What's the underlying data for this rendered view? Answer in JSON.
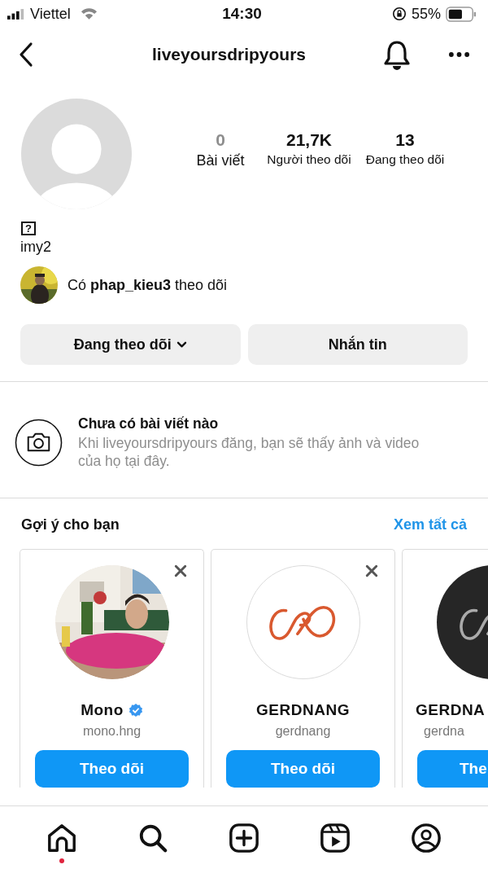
{
  "status_bar": {
    "carrier": "Viettel",
    "time": "14:30",
    "battery": "55%"
  },
  "nav": {
    "title": "liveyoursdripyours"
  },
  "profile": {
    "stats": [
      {
        "value": "0",
        "label": "Bài viết",
        "muted": true
      },
      {
        "value": "21,7K",
        "label": "Người theo dõi",
        "muted": false
      },
      {
        "value": "13",
        "label": "Đang theo dõi",
        "muted": false
      }
    ],
    "bio_symbol": "?",
    "name": "imy2",
    "followed_by": "Có **phap_kieu3** theo dõi"
  },
  "actions": [
    {
      "label": "Đang theo dõi",
      "dropdown": true
    },
    {
      "label": "Nhắn tin",
      "dropdown": false
    }
  ],
  "empty_state": {
    "title": "Chưa có bài viết nào",
    "text": "Khi liveyoursdripyours đăng, bạn sẽ thấy ảnh và video của họ tại đây."
  },
  "suggestions": {
    "title": "Gợi ý cho bạn",
    "see_all": "Xem tất cả",
    "cards": [
      {
        "name": "Mono",
        "verified": true,
        "handle": "mono.hng",
        "button": "Theo dõi",
        "dismissible": true,
        "cut": false
      },
      {
        "kind": "logo",
        "name": "GERDNANG",
        "verified": false,
        "handle": "gerdnang",
        "button": "Theo dõi",
        "dismissible": true,
        "cut": false
      },
      {
        "kind": "dark",
        "name": "GERDNA",
        "verified": false,
        "handle": "gerdna",
        "button": "The",
        "dismissible": false,
        "cut": true
      }
    ]
  },
  "tab_bar": [
    {
      "kind": "home",
      "selected": true,
      "activity": true
    },
    {
      "kind": "search",
      "selected": false,
      "activity": false
    },
    {
      "kind": "create",
      "selected": false,
      "activity": false
    },
    {
      "kind": "reels",
      "selected": false,
      "activity": false
    },
    {
      "kind": "profile",
      "selected": false,
      "activity": false
    }
  ]
}
